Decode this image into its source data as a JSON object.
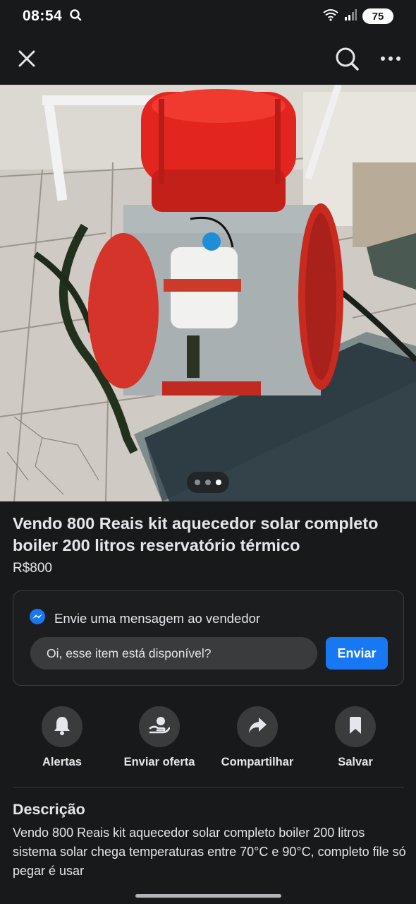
{
  "status_bar": {
    "time": "08:54",
    "battery": "75",
    "icons": [
      "search-status-icon",
      "wifi-icon",
      "signal-icon",
      "battery-icon"
    ]
  },
  "nav": {
    "icons": [
      "close-icon",
      "search-icon",
      "more-icon"
    ]
  },
  "photo": {
    "carousel_count": 3,
    "active_index": 2
  },
  "listing": {
    "title": "Vendo 800 Reais kit aquecedor solar completo boiler 200 litros reservatório térmico",
    "price": "R$800"
  },
  "message": {
    "heading": "Envie uma mensagem ao vendedor",
    "input_value": "Oi, esse item está disponível?",
    "send_label": "Enviar",
    "icon": "messenger-icon",
    "accent": "#1877f2"
  },
  "actions": [
    {
      "label": "Alertas",
      "icon": "bell-icon"
    },
    {
      "label": "Enviar oferta",
      "icon": "offer-icon"
    },
    {
      "label": "Compartilhar",
      "icon": "share-icon"
    },
    {
      "label": "Salvar",
      "icon": "bookmark-icon"
    }
  ],
  "description": {
    "heading": "Descrição",
    "text": "Vendo 800 Reais kit aquecedor solar completo boiler 200 litros sistema solar chega temperaturas entre 70°C e 90°C, completo file só pegar é usar"
  },
  "colors": {
    "background": "#18191a",
    "surface": "#3a3b3c",
    "text": "#e4e6eb"
  }
}
